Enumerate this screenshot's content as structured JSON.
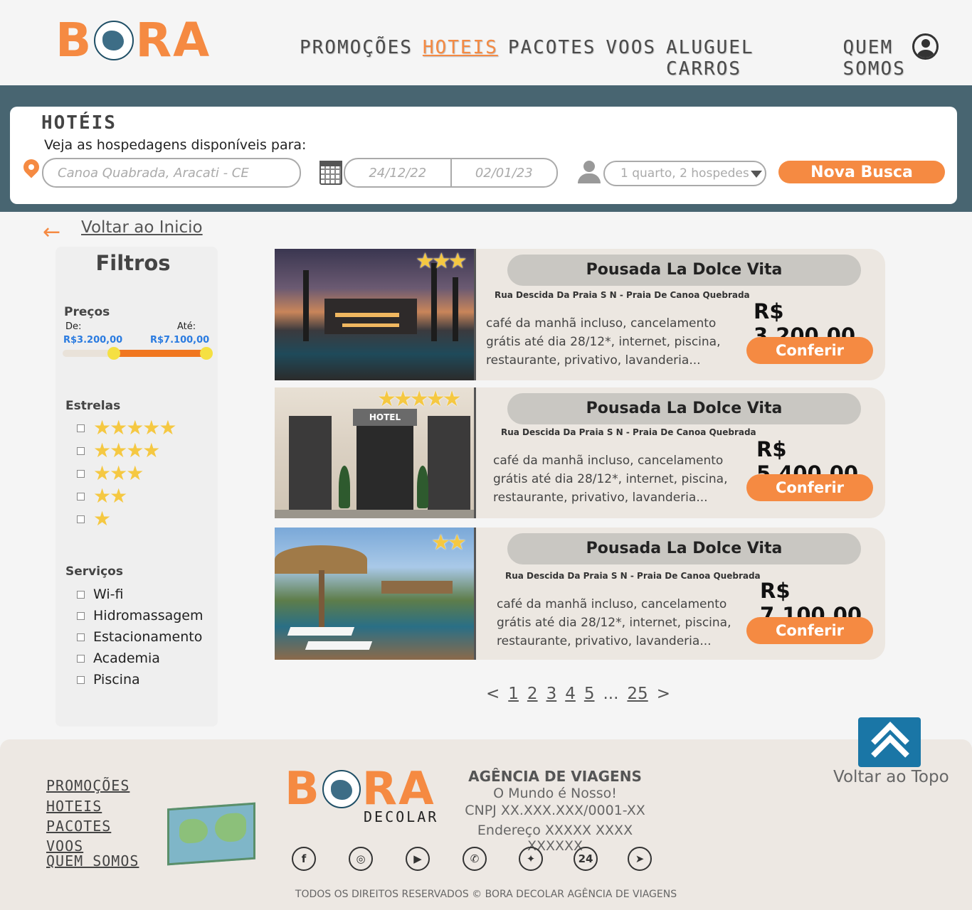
{
  "brand": {
    "name_prefix": "B",
    "name_suffix": "RA",
    "footer_tagline": "DECOLAR",
    "accent_color": "#f58a42"
  },
  "nav": {
    "items": [
      {
        "label": "PROMOÇÕES",
        "active": false
      },
      {
        "label": "HOTEIS",
        "active": true
      },
      {
        "label": "PACOTES",
        "active": false
      },
      {
        "label": "VOOS",
        "active": false
      },
      {
        "label": "ALUGUEL CARROS",
        "active": false
      },
      {
        "label": "QUEM SOMOS",
        "active": false
      }
    ],
    "user_icon": "user-circle-icon"
  },
  "search": {
    "title": "HOTÉIS",
    "subtitle": "Veja as hospedagens disponíveis para:",
    "destination_placeholder": "Canoa Quabrada, Aracati - CE",
    "checkin_placeholder": "24/12/22",
    "checkout_placeholder": "02/01/23",
    "guests_value": "1 quarto, 2 hospedes",
    "button_label": "Nova Busca"
  },
  "back": {
    "label": "Voltar ao Inicio"
  },
  "filters": {
    "title": "Filtros",
    "price": {
      "label": "Preços",
      "from_label": "De:",
      "to_label": "Até:",
      "from_value": "R$3.200,00",
      "to_value": "R$7.100,00"
    },
    "stars": {
      "label": "Estrelas",
      "options": [
        "★★★★★",
        "★★★★",
        "★★★",
        "★★",
        "★"
      ]
    },
    "services": {
      "label": "Serviços",
      "options": [
        "Wi-fi",
        "Hidromassagem",
        "Estacionamento",
        "Academia",
        "Piscina"
      ]
    }
  },
  "hotels": [
    {
      "name": "Pousada La Dolce Vita",
      "stars": "★★★",
      "address": "Rua Descida Da Praia S N - Praia De Canoa Quebrada",
      "description": "café da manhã incluso, cancelamento grátis até dia 28/12*, internet, piscina, restaurante, privativo, lavanderia...",
      "price": "R$ 3.200,00",
      "button": "Conferir"
    },
    {
      "name": "Pousada La Dolce Vita",
      "stars": "★★★★★",
      "address": "Rua Descida Da Praia S N - Praia De Canoa Quebrada",
      "description": "café da manhã incluso, cancelamento grátis até dia 28/12*, internet, piscina, restaurante, privativo, lavanderia...",
      "price": "R$ 5.400,00",
      "button": "Conferir",
      "image_text": "HOTEL"
    },
    {
      "name": "Pousada La Dolce Vita",
      "stars": "★★",
      "address": "Rua Descida Da Praia S N - Praia De Canoa Quebrada",
      "description": "café da manhã incluso, cancelamento grátis até dia 28/12*, internet, piscina, restaurante, privativo, lavanderia...",
      "price": "R$ 7.100,00",
      "button": "Conferir"
    }
  ],
  "pagination": {
    "prev": "<",
    "pages": [
      "1",
      "2",
      "3",
      "4",
      "5"
    ],
    "ellipsis": "...",
    "last": "25",
    "next": ">"
  },
  "footer": {
    "to_top_label": "Voltar ao Topo",
    "nav": [
      "PROMOÇÕES",
      "HOTEIS",
      "PACOTES",
      "VOOS",
      "QUEM SOMOS"
    ],
    "agency_title": "AGÊNCIA DE VIAGENS",
    "slogan": "O Mundo é Nosso!",
    "cnpj": "CNPJ XX.XXX.XXX/0001-XX",
    "address": "Endereço XXXXX XXXX XXXXXX",
    "social": [
      {
        "icon": "facebook-icon",
        "glyph": "f"
      },
      {
        "icon": "instagram-icon",
        "glyph": "◎"
      },
      {
        "icon": "youtube-icon",
        "glyph": "▶"
      },
      {
        "icon": "whatsapp-icon",
        "glyph": "✆"
      },
      {
        "icon": "twitter-icon",
        "glyph": "✦"
      },
      {
        "icon": "phone-24h-icon",
        "glyph": "24"
      },
      {
        "icon": "telegram-icon",
        "glyph": "➤"
      }
    ],
    "copyright": "TODOS OS DIREITOS RESERVADOS © BORA DECOLAR AGÊNCIA DE VIAGENS"
  }
}
